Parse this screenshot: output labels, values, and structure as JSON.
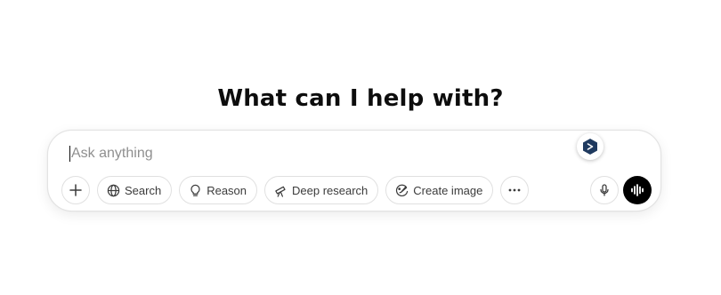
{
  "headline": "What can I help with?",
  "composer": {
    "placeholder": "Ask anything",
    "value": ""
  },
  "toolbar": {
    "add_icon": "plus-icon",
    "tools": [
      {
        "label": "Search",
        "icon": "globe-icon"
      },
      {
        "label": "Reason",
        "icon": "lightbulb-icon"
      },
      {
        "label": "Deep research",
        "icon": "telescope-icon"
      },
      {
        "label": "Create image",
        "icon": "image-brush-icon"
      }
    ],
    "more_icon": "ellipsis-icon",
    "mic_icon": "microphone-icon",
    "voice_icon": "voice-waveform-icon"
  },
  "extension_badge": {
    "icon": "extension-logo-icon",
    "color": "#1f3a5f"
  },
  "colors": {
    "accent": "#000000",
    "border": "#e3e3e3",
    "placeholder": "#8f8f8f"
  }
}
